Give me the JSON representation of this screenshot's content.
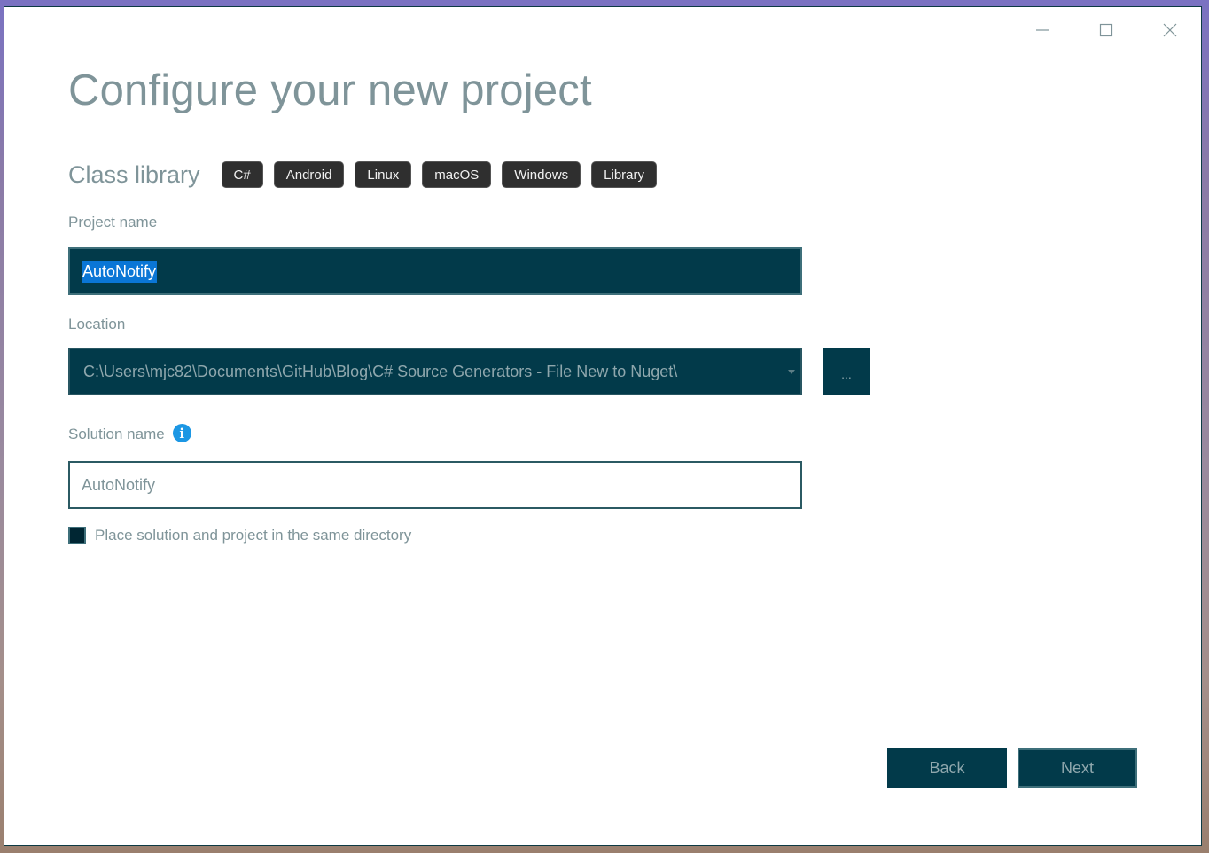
{
  "window": {
    "caption_buttons": [
      {
        "name": "minimize",
        "icon": "minimize-icon"
      },
      {
        "name": "maximize",
        "icon": "maximize-icon"
      },
      {
        "name": "close",
        "icon": "close-icon"
      }
    ]
  },
  "header": {
    "title": "Configure your new project",
    "template_name": "Class library",
    "tags": [
      "C#",
      "Android",
      "Linux",
      "macOS",
      "Windows",
      "Library"
    ]
  },
  "form": {
    "project_name": {
      "label": "Project name",
      "value": "AutoNotify",
      "selected": true
    },
    "location": {
      "label": "Location",
      "value": "C:\\Users\\mjc82\\Documents\\GitHub\\Blog\\C# Source Generators - File New to Nuget\\",
      "browse_label": "..."
    },
    "solution_name": {
      "label": "Solution name",
      "info_icon": "i",
      "value": "AutoNotify"
    },
    "same_directory": {
      "label": "Place solution and project in the same directory",
      "checked": false
    }
  },
  "footer": {
    "back_label": "Back",
    "next_label": "Next"
  },
  "colors": {
    "field_bg": "#023a4a",
    "selection": "#0a76d6",
    "info": "#1c97e4",
    "text_muted": "#7f9499",
    "tag_bg": "#2f2f2f"
  }
}
